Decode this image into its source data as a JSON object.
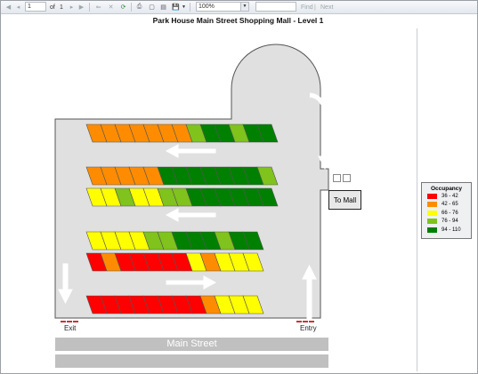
{
  "toolbar": {
    "page_current": "1",
    "page_of": "of",
    "page_total": "1",
    "zoom": "100%",
    "find_label": "Find",
    "separator": "|",
    "next_label": "Next"
  },
  "report": {
    "title": "Park House Main Street Shopping Mall - Level 1"
  },
  "map": {
    "exit_label": "Exit",
    "entry_label": "Entry",
    "mall_label": "To Mall",
    "street_label": "Main Street"
  },
  "legend": {
    "title": "Occupancy",
    "items": [
      {
        "label": "36 - 42",
        "color": "#ff0000"
      },
      {
        "label": "42 - 65",
        "color": "#ff8c00"
      },
      {
        "label": "66 - 76",
        "color": "#ffff00"
      },
      {
        "label": "76 - 94",
        "color": "#7fc31c"
      },
      {
        "label": "94 - 110",
        "color": "#008000"
      }
    ]
  },
  "colors": {
    "red": "#ff0000",
    "orange": "#ff8c00",
    "yellow": "#ffff00",
    "lightgreen": "#7fc31c",
    "darkgreen": "#008000",
    "floor": "#e0e0e0",
    "road": "#c0c0c0"
  },
  "parking_rows": [
    {
      "name": "row-1",
      "slots": [
        "orange",
        "orange",
        "orange",
        "orange",
        "orange",
        "orange",
        "orange",
        "lightgreen",
        "darkgreen",
        "darkgreen",
        "lightgreen",
        "darkgreen",
        "darkgreen"
      ]
    },
    {
      "name": "row-2",
      "slots": [
        "orange",
        "orange",
        "orange",
        "orange",
        "orange",
        "darkgreen",
        "darkgreen",
        "darkgreen",
        "darkgreen",
        "darkgreen",
        "darkgreen",
        "darkgreen",
        "lightgreen"
      ]
    },
    {
      "name": "row-3",
      "slots": [
        "yellow",
        "yellow",
        "lightgreen",
        "yellow",
        "yellow",
        "lightgreen",
        "lightgreen",
        "darkgreen",
        "darkgreen",
        "darkgreen",
        "darkgreen",
        "darkgreen",
        "darkgreen"
      ]
    },
    {
      "name": "row-4",
      "slots": [
        "yellow",
        "yellow",
        "yellow",
        "yellow",
        "lightgreen",
        "lightgreen",
        "darkgreen",
        "darkgreen",
        "darkgreen",
        "lightgreen",
        "darkgreen",
        "darkgreen"
      ]
    },
    {
      "name": "row-5",
      "slots": [
        "red",
        "orange",
        "red",
        "red",
        "red",
        "red",
        "red",
        "yellow",
        "orange",
        "yellow",
        "yellow",
        "yellow"
      ]
    },
    {
      "name": "row-6",
      "slots": [
        "red",
        "red",
        "red",
        "red",
        "red",
        "red",
        "red",
        "red",
        "orange",
        "yellow",
        "yellow",
        "yellow"
      ]
    }
  ]
}
